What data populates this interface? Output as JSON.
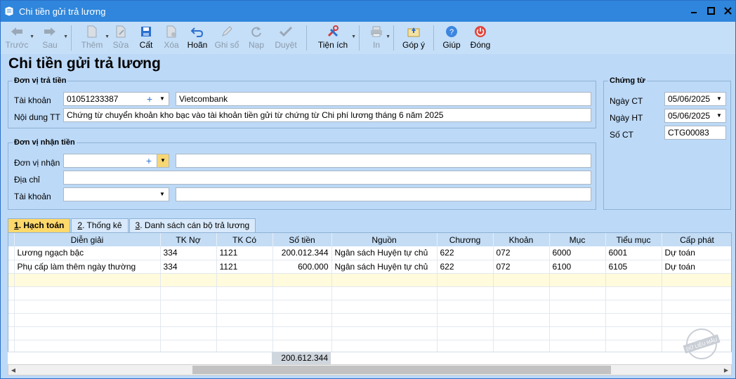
{
  "window": {
    "title": "Chi tiền gửi trả lương"
  },
  "toolbar": {
    "prev": "Trước",
    "next": "Sau",
    "add": "Thêm",
    "edit": "Sửa",
    "save": "Cất",
    "delete": "Xóa",
    "undo": "Hoãn",
    "post": "Ghi sổ",
    "load": "Nạp",
    "approve": "Duyệt",
    "utilities": "Tiện ích",
    "print": "In",
    "feedback": "Góp ý",
    "help": "Giúp",
    "close": "Đóng"
  },
  "page_title": "Chi tiền gửi trả lương",
  "payer": {
    "legend": "Đơn vị trả tiền",
    "account_label": "Tài khoản",
    "account_value": "01051233387",
    "bank_value": "Vietcombank",
    "content_label": "Nội dung TT",
    "content_value": "Chứng từ chuyển khoản kho bạc vào tài khoản tiền gửi từ chứng từ Chi phí lương tháng 6 năm 2025"
  },
  "receiver": {
    "legend": "Đơn vị nhận tiền",
    "unit_label": "Đơn vị nhận",
    "address_label": "Địa chỉ",
    "account_label": "Tài khoản"
  },
  "voucher": {
    "legend": "Chứng từ",
    "date_ct_label": "Ngày CT",
    "date_ct_value": "05/06/2025",
    "date_ht_label": "Ngày HT",
    "date_ht_value": "05/06/2025",
    "so_ct_label": "Số CT",
    "so_ct_value": "CTG00083"
  },
  "tabs": [
    {
      "key": "1",
      "label": ". Hạch toán"
    },
    {
      "key": "2",
      "label": ". Thống kê"
    },
    {
      "key": "3",
      "label": ". Danh sách cán bộ trả lương"
    }
  ],
  "grid": {
    "columns": [
      "Diễn giải",
      "TK Nợ",
      "TK Có",
      "Số tiền",
      "Nguồn",
      "Chương",
      "Khoản",
      "Mục",
      "Tiểu mục",
      "Cấp phát"
    ],
    "rows": [
      [
        "Lương ngạch bậc",
        "334",
        "1121",
        "200.012.344",
        "Ngân sách Huyện tự chủ",
        "622",
        "072",
        "6000",
        "6001",
        "Dự toán"
      ],
      [
        "Phụ cấp làm thêm ngày thường",
        "334",
        "1121",
        "600.000",
        "Ngân sách Huyện tự chủ",
        "622",
        "072",
        "6100",
        "6105",
        "Dự toán"
      ]
    ],
    "total": "200.612.344"
  },
  "stamp_text": "DỮ LIỆU MẪU"
}
